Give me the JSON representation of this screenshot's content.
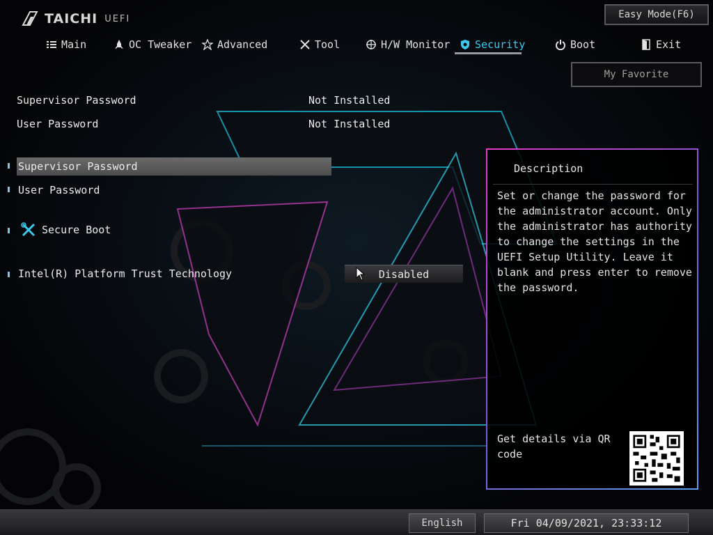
{
  "logo": {
    "brand": "TAICHI",
    "sub": "UEFI"
  },
  "header": {
    "easy_mode": "Easy Mode(F6)",
    "my_favorite": "My Favorite"
  },
  "tabs": [
    {
      "label": "Main",
      "icon": "list-icon"
    },
    {
      "label": "OC Tweaker",
      "icon": "rocket-icon"
    },
    {
      "label": "Advanced",
      "icon": "star-icon"
    },
    {
      "label": "Tool",
      "icon": "tools-icon"
    },
    {
      "label": "H/W Monitor",
      "icon": "crosshair-icon"
    },
    {
      "label": "Security",
      "icon": "shield-icon",
      "active": true
    },
    {
      "label": "Boot",
      "icon": "power-icon"
    },
    {
      "label": "Exit",
      "icon": "exit-icon"
    }
  ],
  "status": [
    {
      "label": "Supervisor Password",
      "value": "Not Installed"
    },
    {
      "label": "User Password",
      "value": "Not Installed"
    }
  ],
  "menu": {
    "items": [
      {
        "label": "Supervisor Password",
        "selected": true
      },
      {
        "label": "User Password"
      },
      {
        "label": "Secure Boot",
        "icon": "tools-icon"
      },
      {
        "label": "Intel(R) Platform Trust Technology",
        "value": "Disabled"
      }
    ]
  },
  "description": {
    "title": "Description",
    "text": "Set or change the password for the administrator account. Only the administrator has authority to change the settings in the UEFI Setup Utility. Leave it blank and press enter to remove the password.",
    "qr_label": "Get details via QR code"
  },
  "footer": {
    "language": "English",
    "datetime": "Fri 04/09/2021, 23:33:12"
  },
  "colors": {
    "accent": "#3ec8f0",
    "panel_border_start": "#e03cc8",
    "panel_border_end": "#5aa0f0"
  }
}
